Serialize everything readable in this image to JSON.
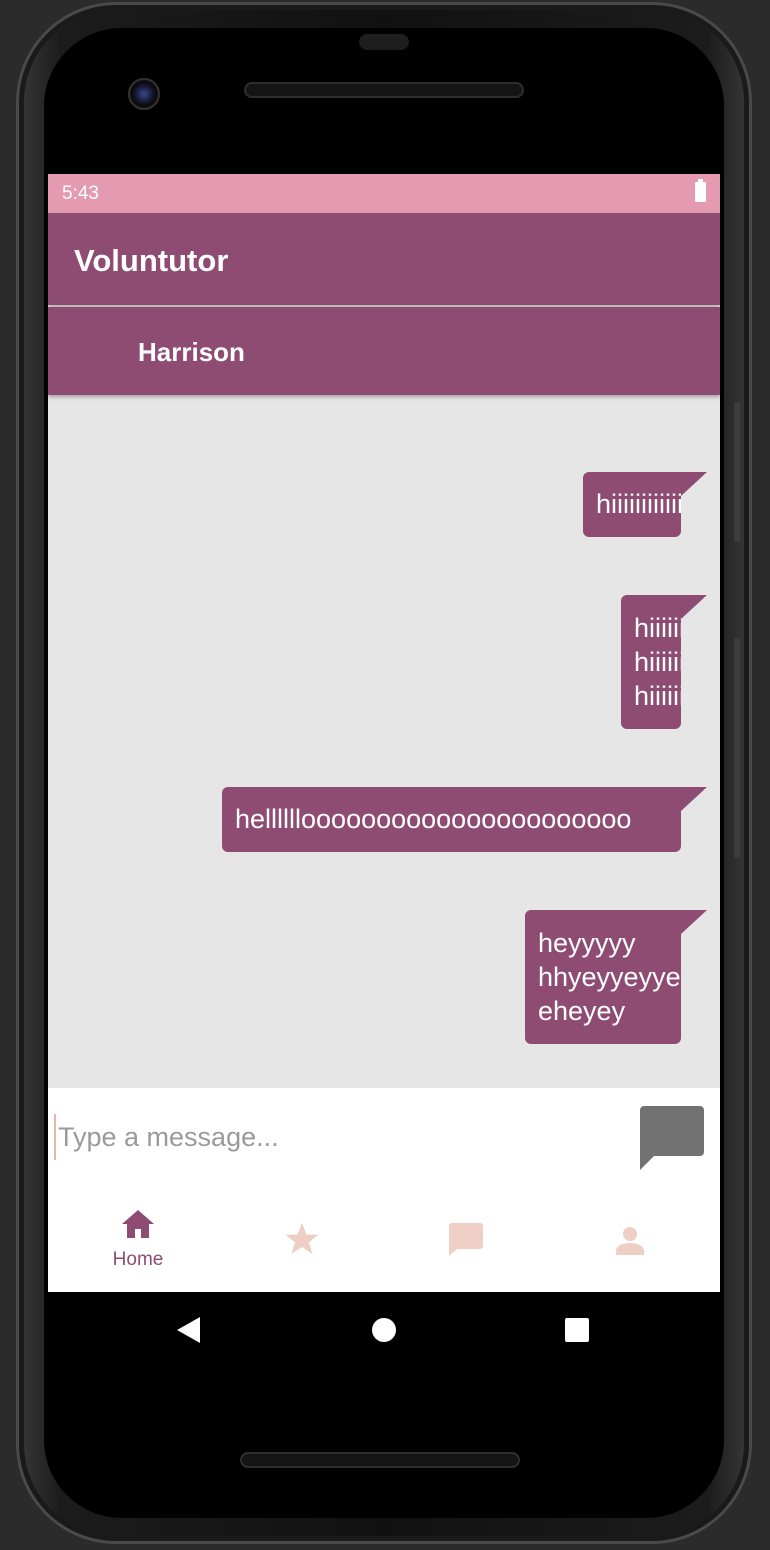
{
  "status_bar": {
    "time": "5:43",
    "battery_icon": "battery-full-icon"
  },
  "app_bar": {
    "title": "Voluntutor"
  },
  "chat_header": {
    "contact_name": "Harrison"
  },
  "messages": [
    {
      "lines": [
        "hiiiiiiiiiiii"
      ]
    },
    {
      "lines": [
        "hiiiiiiiiiiiiii",
        "hiiiiiiiiiiiiii",
        "hiiiiiiiiiiiiii"
      ]
    },
    {
      "lines": [
        "helllllloooooooooooooooooooooo"
      ]
    },
    {
      "lines": [
        "heyyyyy",
        "hhyeyyeyyey",
        "eheyey"
      ]
    }
  ],
  "composer": {
    "placeholder": "Type a message...",
    "value": "",
    "send_icon": "send-message-icon"
  },
  "bottom_nav": {
    "items": [
      {
        "icon": "home-icon",
        "label": "Home",
        "selected": true
      },
      {
        "icon": "star-icon",
        "label": "",
        "selected": false
      },
      {
        "icon": "chat-icon",
        "label": "",
        "selected": false
      },
      {
        "icon": "person-icon",
        "label": "",
        "selected": false
      }
    ]
  },
  "system_nav": {
    "back_icon": "back-icon",
    "home_icon": "home-circle-icon",
    "recents_icon": "recents-icon"
  },
  "colors": {
    "primary": "#8f4c73",
    "status_bar": "#e49ab1",
    "chat_background": "#e6e6e6",
    "nav_inactive": "#efcfc5",
    "send_button": "#727272"
  }
}
